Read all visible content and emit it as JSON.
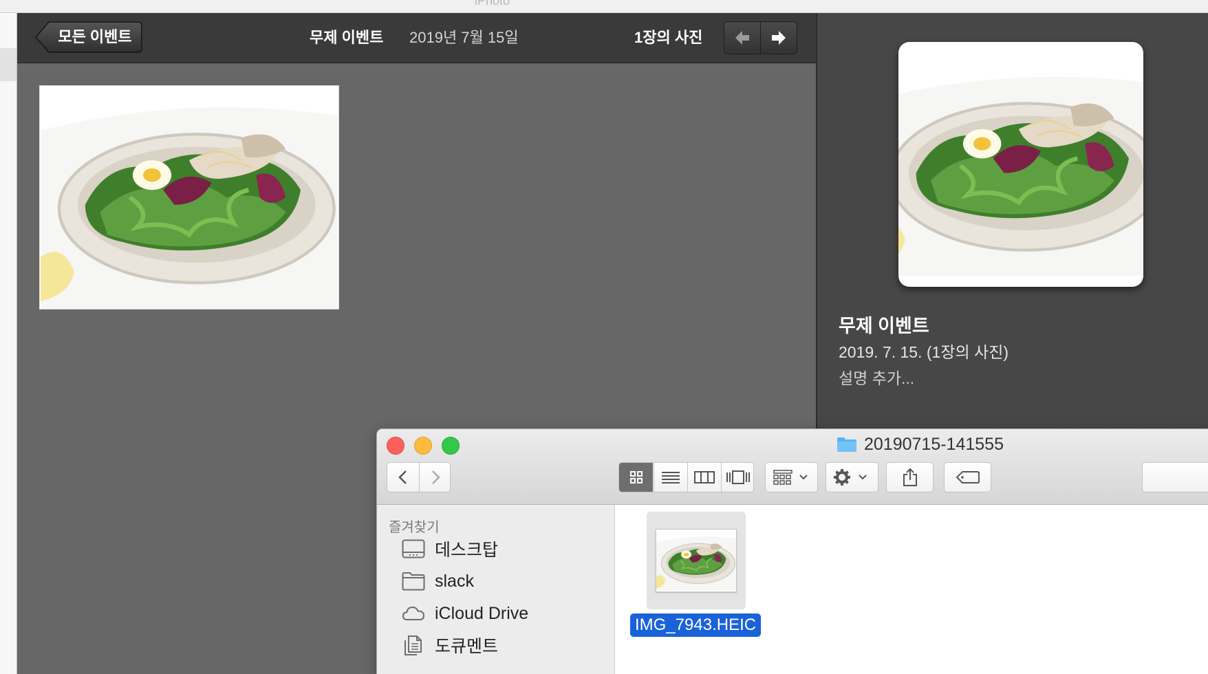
{
  "app": {
    "title": "iPhoto"
  },
  "toolbar": {
    "back_label": "모든 이벤트",
    "event_title": "무제 이벤트",
    "event_date": "2019년 7월 15일",
    "photo_count": "1장의 사진"
  },
  "info": {
    "title": "무제 이벤트",
    "date": "2019. 7. 15. (1장의 사진)",
    "description_placeholder": "설명 추가..."
  },
  "finder": {
    "folder_name": "20190715-141555",
    "sidebar": {
      "heading": "즐겨찾기",
      "items": [
        {
          "label": "데스크탑",
          "icon": "desktop-icon"
        },
        {
          "label": "slack",
          "icon": "folder-icon"
        },
        {
          "label": "iCloud Drive",
          "icon": "cloud-icon"
        },
        {
          "label": "도큐멘트",
          "icon": "documents-icon"
        }
      ]
    },
    "view_modes": [
      "icon-view",
      "list-view",
      "column-view",
      "cover-flow-view"
    ],
    "active_view": "icon-view",
    "file": {
      "name": "IMG_7943.HEIC",
      "selected": true
    }
  },
  "colors": {
    "selection": "#1a62d8",
    "close": "#fc605b",
    "minimize": "#fdbc40",
    "maximize": "#34c84a"
  }
}
